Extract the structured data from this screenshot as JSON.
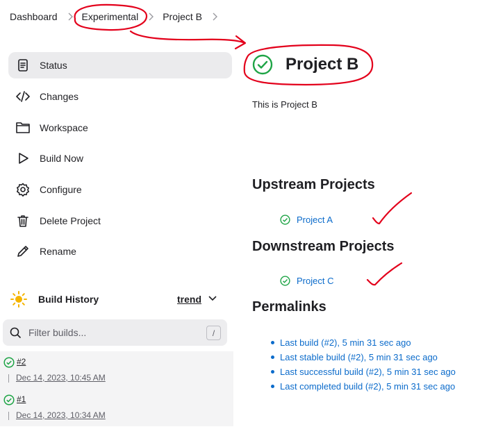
{
  "breadcrumb": [
    "Dashboard",
    "Experimental",
    "Project B"
  ],
  "sidebar": {
    "items": [
      {
        "label": "Status",
        "icon": "document-icon"
      },
      {
        "label": "Changes",
        "icon": "code-icon"
      },
      {
        "label": "Workspace",
        "icon": "folder-icon"
      },
      {
        "label": "Build Now",
        "icon": "play-icon"
      },
      {
        "label": "Configure",
        "icon": "gear-icon"
      },
      {
        "label": "Delete Project",
        "icon": "trash-icon"
      },
      {
        "label": "Rename",
        "icon": "pencil-icon"
      }
    ]
  },
  "build_history": {
    "title": "Build History",
    "trend_label": "trend",
    "filter_placeholder": "Filter builds...",
    "filter_shortcut": "/",
    "builds": [
      {
        "number": "#2",
        "date": "Dec 14, 2023, 10:45 AM"
      },
      {
        "number": "#1",
        "date": "Dec 14, 2023, 10:34 AM"
      }
    ]
  },
  "main": {
    "title": "Project B",
    "description": "This is Project B",
    "upstream_heading": "Upstream Projects",
    "upstream": [
      "Project A"
    ],
    "downstream_heading": "Downstream Projects",
    "downstream": [
      "Project C"
    ],
    "permalinks_heading": "Permalinks",
    "permalinks": [
      "Last build (#2), 5 min 31 sec ago",
      "Last stable build (#2), 5 min 31 sec ago",
      "Last successful build (#2), 5 min 31 sec ago",
      "Last completed build (#2), 5 min 31 sec ago"
    ]
  },
  "colors": {
    "link": "#0b6bcb",
    "success": "#1ea446",
    "annotation": "#e3001b"
  }
}
